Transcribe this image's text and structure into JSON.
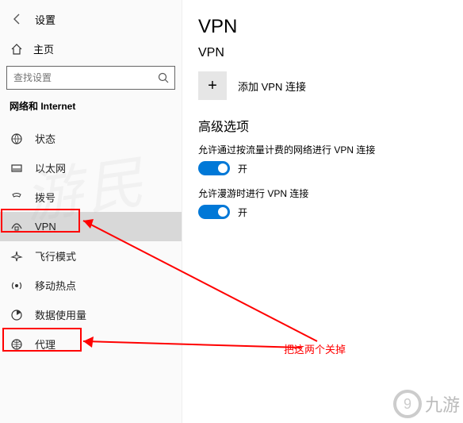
{
  "header": {
    "settings_label": "设置",
    "home_label": "主页"
  },
  "search": {
    "placeholder": "查找设置"
  },
  "section_title": "网络和 Internet",
  "sidebar": {
    "items": [
      {
        "icon": "status-icon",
        "label": "状态"
      },
      {
        "icon": "ethernet-icon",
        "label": "以太网"
      },
      {
        "icon": "dialup-icon",
        "label": "拨号"
      },
      {
        "icon": "vpn-icon",
        "label": "VPN"
      },
      {
        "icon": "airplane-icon",
        "label": "飞行模式"
      },
      {
        "icon": "hotspot-icon",
        "label": "移动热点"
      },
      {
        "icon": "data-usage-icon",
        "label": "数据使用量"
      },
      {
        "icon": "proxy-icon",
        "label": "代理"
      }
    ],
    "active_index": 3
  },
  "main": {
    "title": "VPN",
    "sub_title": "VPN",
    "add_label": "添加 VPN 连接",
    "advanced_title": "高级选项",
    "options": [
      {
        "label": "允许通过按流量计费的网络进行 VPN 连接",
        "state": "开",
        "on": true
      },
      {
        "label": "允许漫游时进行 VPN 连接",
        "state": "开",
        "on": true
      }
    ]
  },
  "annotation": {
    "text": "把这两个关掉"
  },
  "watermark": "游民",
  "brand": "九游"
}
